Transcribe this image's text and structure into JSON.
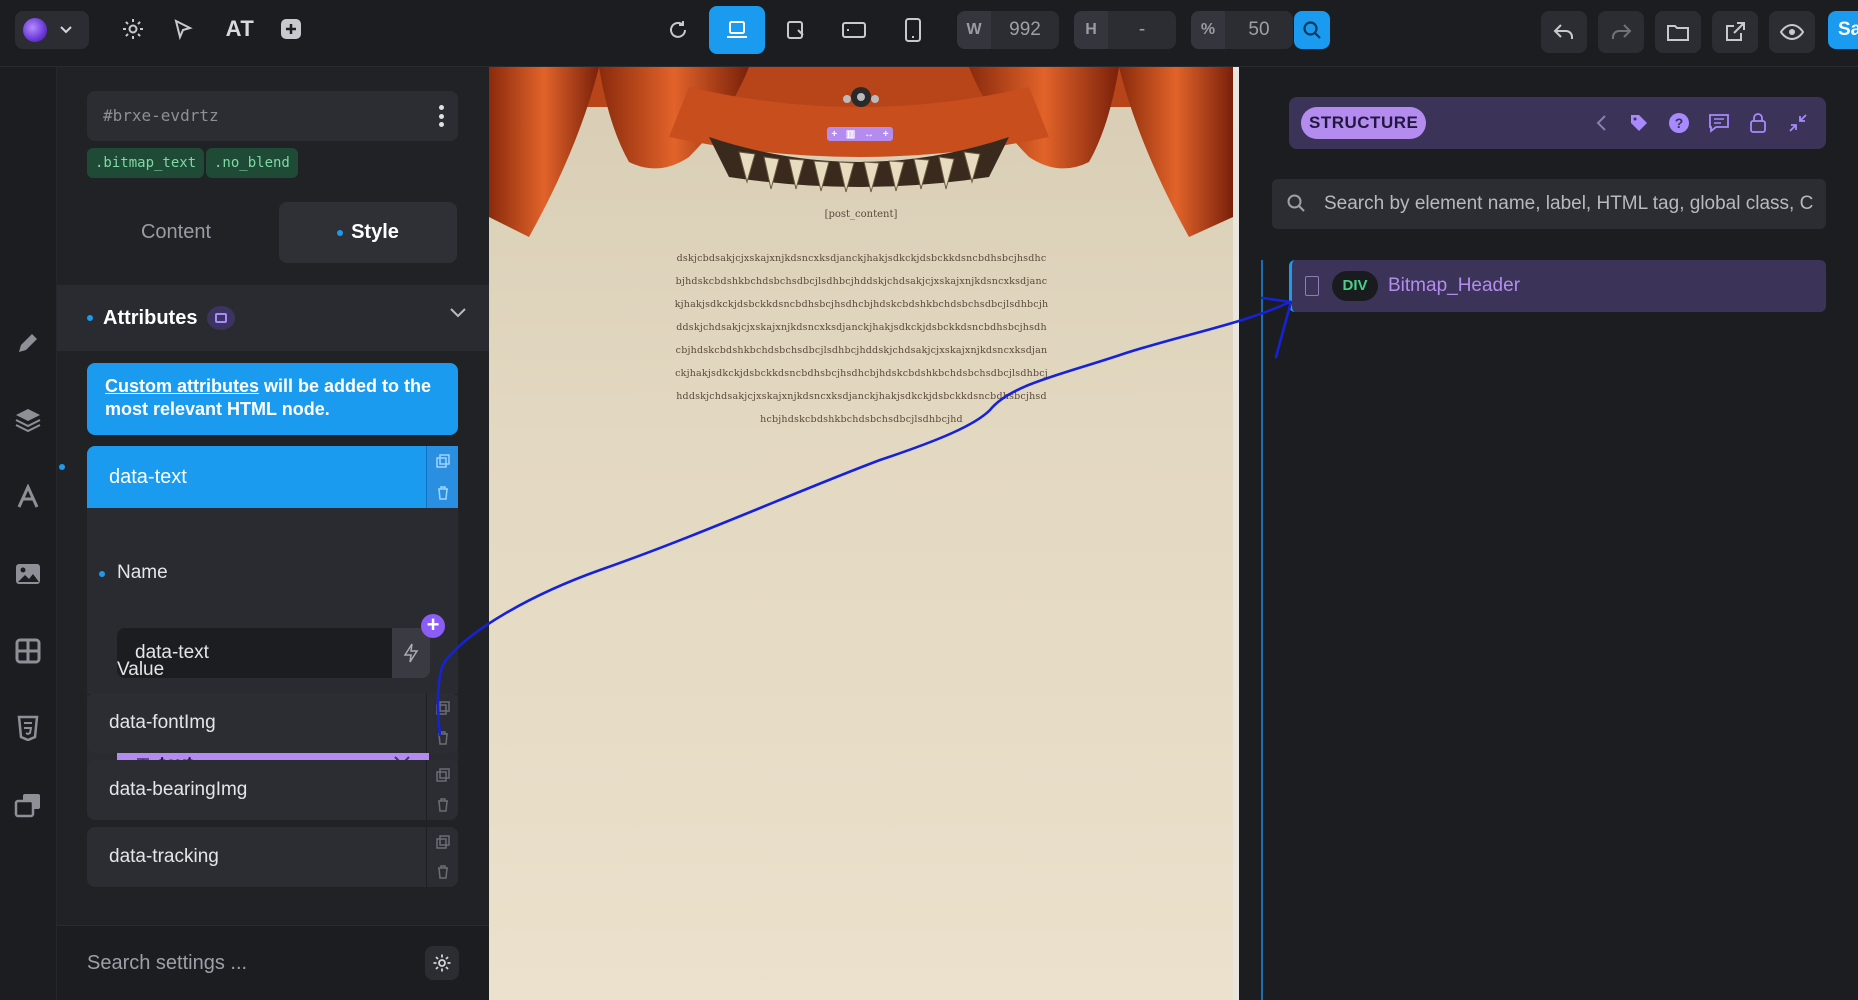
{
  "toolbar": {
    "at_label": "AT",
    "width_label": "W",
    "width_value": "992",
    "height_label": "H",
    "height_value": "-",
    "zoom_label": "%",
    "zoom_value": "50",
    "save_label": "Sa"
  },
  "element": {
    "id": "#brxe-evdrtz",
    "classes": [
      ".bitmap_text",
      ".no_blend"
    ]
  },
  "tabs": {
    "content": "Content",
    "style": "Style"
  },
  "attributes_section": {
    "title": "Attributes",
    "info_link": "Custom attributes",
    "info_rest": " will be added to the most relevant HTML node.",
    "active_attr": "data-text",
    "name_label": "Name",
    "name_value": "data-text",
    "value_label": "Value",
    "value_selected": "text",
    "other_attrs": [
      "data-fontImg",
      "data-bearingImg",
      "data-tracking"
    ]
  },
  "search_settings_placeholder": "Search settings ...",
  "canvas": {
    "post_content": "[post_content]",
    "gibberish": "dskjcbdsakjcjxskajxnjkdsncxksdjanckjhakjsdkckjdsbckkdsncbdhsbcjhsdhcbjhdskcbdshkbchdsbchsdbcjlsdhbcjhddskjchdsakjcjxskajxnjkdsncxksdjanckjhakjsdkckjdsbckkdsncbdhsbcjhsdhcbjhdskcbdshkbchdsbchsdbcjlsdhbcjhddskjchdsakjcjxskajxnjkdsncxksdjanckjhakjsdkckjdsbckkdsncbdhsbcjhsdhcbjhdskcbdshkbchdsbchsdbcjlsdhbcjhddskjchdsakjcjxskajxnjkdsncxksdjanckjhakjsdkckjdsbckkdsncbdhsbcjhsdhcbjhdskcbdshkbchdsbchsdbcjlsdhbcjhddskjchdsakjcjxskajxnjkdsncxksdjanckjhakjsdkckjdsbckkdsncbdhsbcjhsdhcbjhdskcbdshkbchdsbchsdbcjlsdhbcjhd"
  },
  "structure": {
    "title": "STRUCTURE",
    "search_placeholder": "Search by element name, label, HTML tag, global class, C",
    "tree": [
      {
        "tag": "DIV",
        "label": "Bitmap_Header"
      }
    ]
  },
  "colors": {
    "accent": "#1a9bf0",
    "purple": "#b48cf0",
    "annotation": "#1622d8"
  }
}
